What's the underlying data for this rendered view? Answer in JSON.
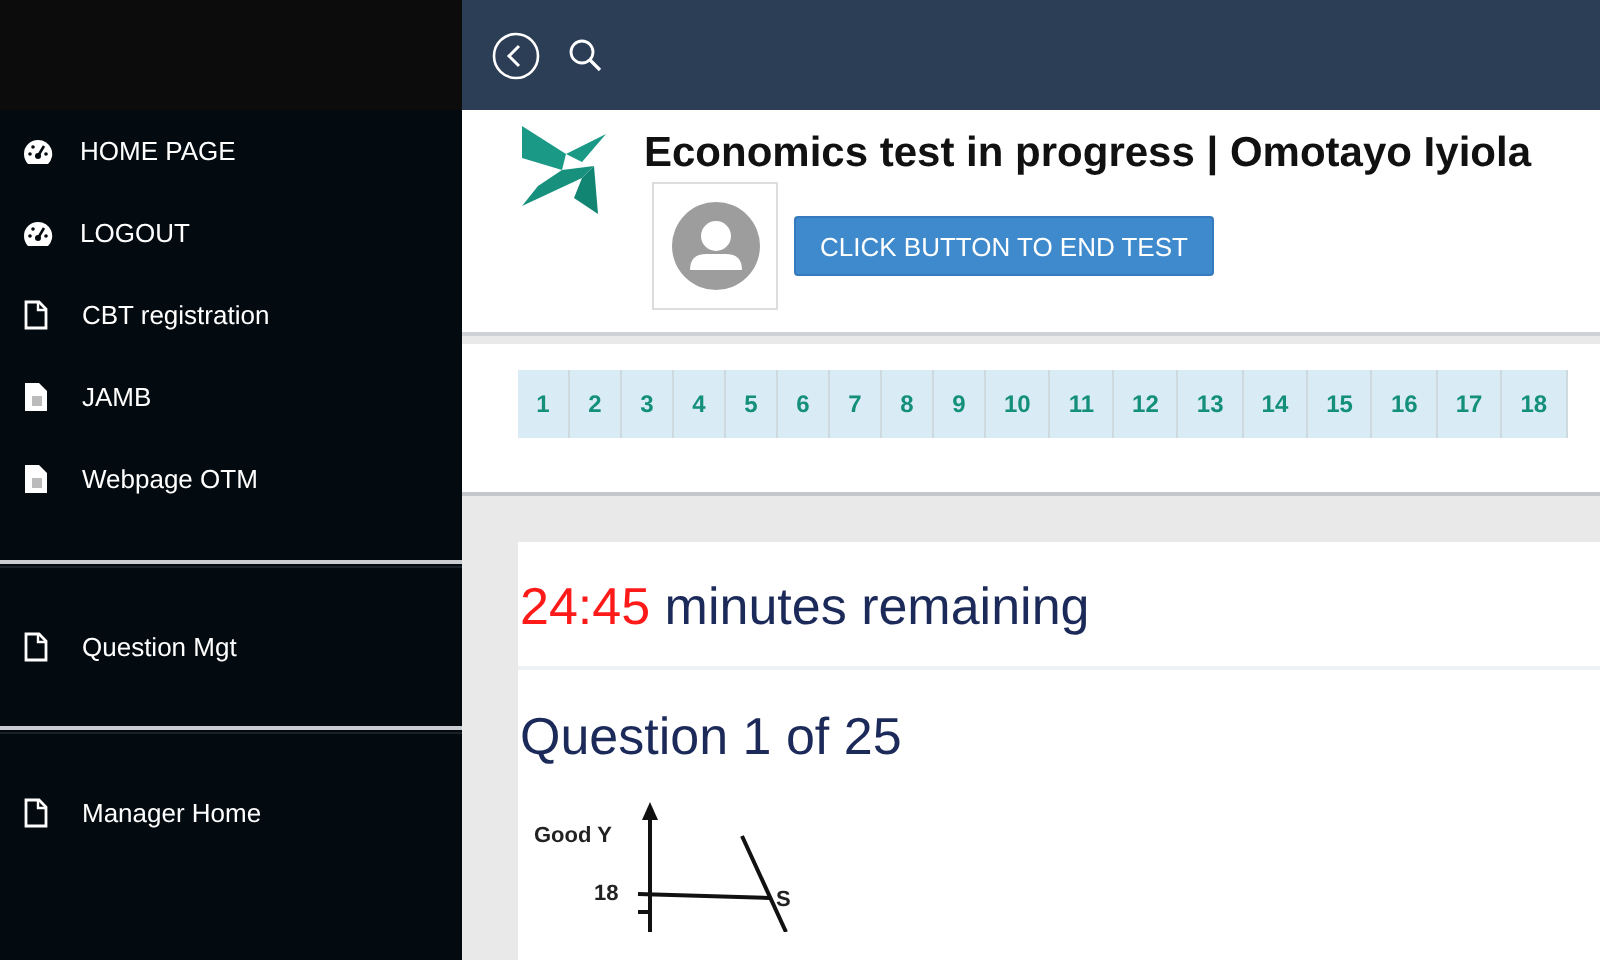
{
  "sidebar": {
    "groups": [
      {
        "items": [
          {
            "label": "HOME PAGE",
            "kind": "dashboard"
          },
          {
            "label": "LOGOUT",
            "kind": "dashboard"
          },
          {
            "label": "CBT registration",
            "kind": "page"
          },
          {
            "label": "JAMB",
            "kind": "page-filled"
          },
          {
            "label": "Webpage OTM",
            "kind": "page-filled"
          }
        ]
      },
      {
        "items": [
          {
            "label": "Question Mgt",
            "kind": "page"
          }
        ]
      },
      {
        "items": [
          {
            "label": "Manager Home",
            "kind": "page"
          }
        ]
      }
    ]
  },
  "header": {
    "title": "Economics test in progress | Omotayo Iyiola",
    "end_button": "CLICK BUTTON TO END TEST"
  },
  "pager": [
    "1",
    "2",
    "3",
    "4",
    "5",
    "6",
    "7",
    "8",
    "9",
    "10",
    "11",
    "12",
    "13",
    "14",
    "15",
    "16",
    "17",
    "18"
  ],
  "timer": {
    "time": "24:45",
    "label": "minutes remaining"
  },
  "question": {
    "heading": "Question 1 of 25",
    "figure_labels": {
      "axis": "Good Y",
      "tick": "18",
      "point": "S"
    }
  }
}
